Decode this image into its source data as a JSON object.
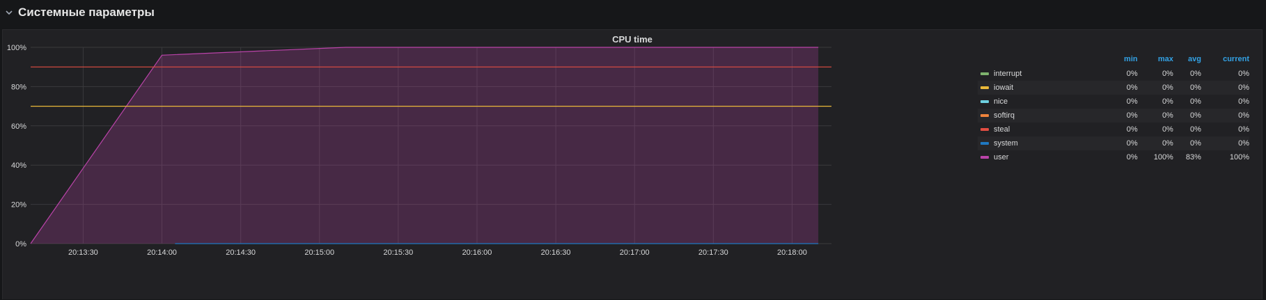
{
  "row": {
    "title": "Системные параметры",
    "chevron_icon": "chevron-down-icon"
  },
  "panel": {
    "title": "CPU time"
  },
  "legend": {
    "columns": [
      "min",
      "max",
      "avg",
      "current"
    ],
    "items": [
      {
        "name": "interrupt",
        "color": "#7eb26d",
        "min": "0%",
        "max": "0%",
        "avg": "0%",
        "current": "0%"
      },
      {
        "name": "iowait",
        "color": "#eab839",
        "min": "0%",
        "max": "0%",
        "avg": "0%",
        "current": "0%"
      },
      {
        "name": "nice",
        "color": "#6ed0e0",
        "min": "0%",
        "max": "0%",
        "avg": "0%",
        "current": "0%"
      },
      {
        "name": "softirq",
        "color": "#ef843c",
        "min": "0%",
        "max": "0%",
        "avg": "0%",
        "current": "0%"
      },
      {
        "name": "steal",
        "color": "#e24d42",
        "min": "0%",
        "max": "0%",
        "avg": "0%",
        "current": "0%"
      },
      {
        "name": "system",
        "color": "#1f78c1",
        "min": "0%",
        "max": "0%",
        "avg": "0%",
        "current": "0%"
      },
      {
        "name": "user",
        "color": "#ba43a9",
        "min": "0%",
        "max": "100%",
        "avg": "83%",
        "current": "100%"
      }
    ]
  },
  "chart_data": {
    "type": "area",
    "title": "CPU time",
    "x_tick_labels": [
      "20:13:30",
      "20:14:00",
      "20:14:30",
      "20:15:00",
      "20:15:30",
      "20:16:00",
      "20:16:30",
      "20:17:00",
      "20:17:30",
      "20:18:00"
    ],
    "y_tick_labels": [
      "0%",
      "20%",
      "40%",
      "60%",
      "80%",
      "100%"
    ],
    "ylim": [
      0,
      100
    ],
    "xlim": [
      "20:13:10",
      "20:18:15"
    ],
    "grid": true,
    "thresholds": [
      {
        "value": 90,
        "color": "#e24d42"
      },
      {
        "value": 70,
        "color": "#eab839"
      }
    ],
    "series": [
      {
        "name": "user",
        "color": "#ba43a9",
        "x": [
          "20:13:10",
          "20:14:00",
          "20:15:10",
          "20:18:00",
          "20:18:10"
        ],
        "values": [
          0,
          96,
          100,
          100,
          100
        ]
      },
      {
        "name": "system",
        "color": "#1f78c1",
        "x": [
          "20:14:05",
          "20:18:10"
        ],
        "values": [
          0,
          0
        ]
      }
    ]
  }
}
